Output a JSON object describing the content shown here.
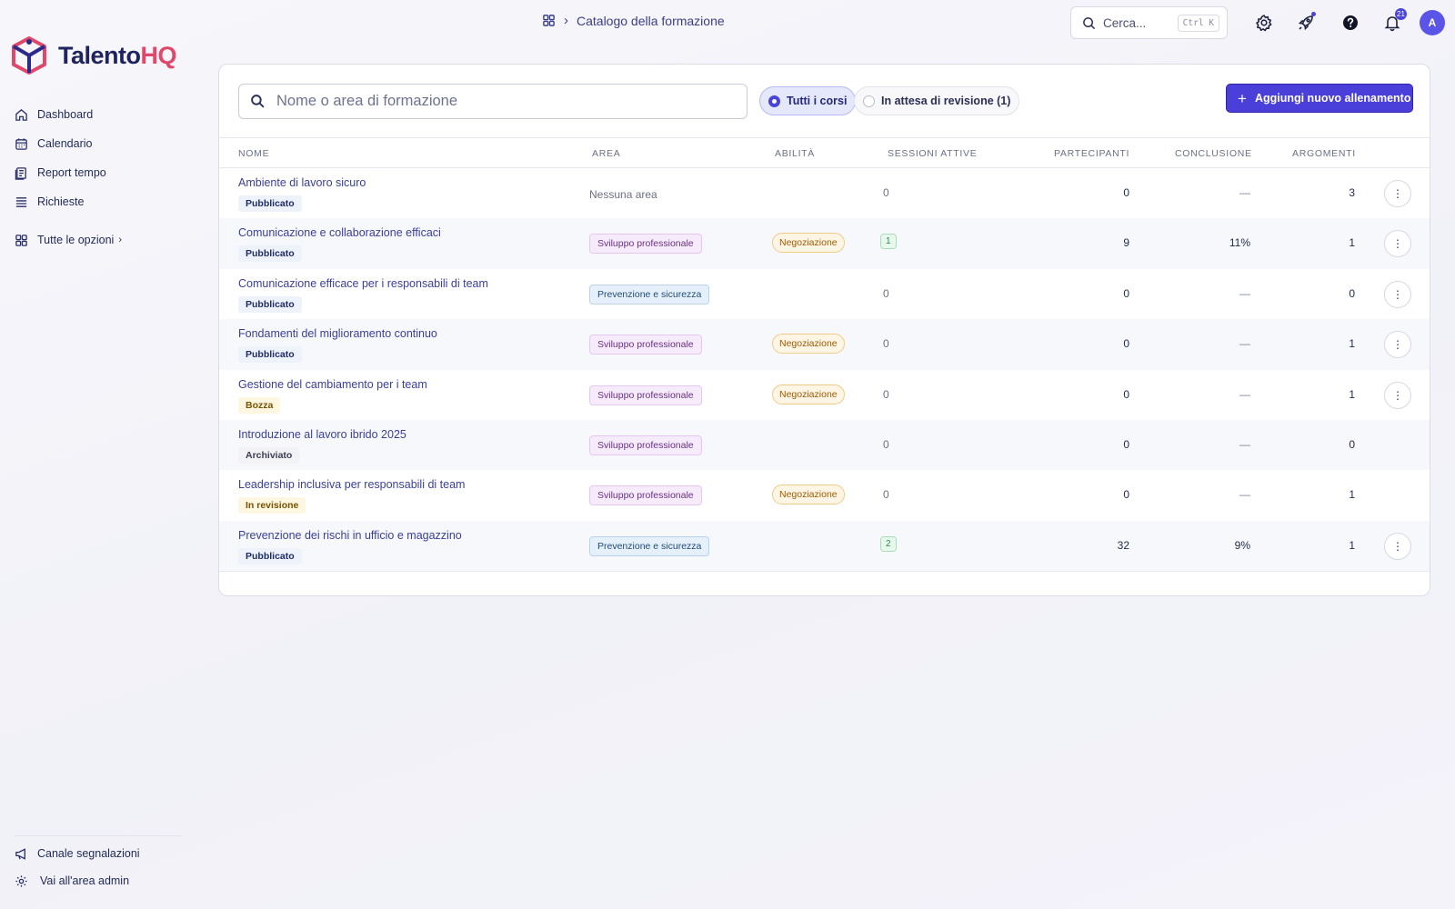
{
  "app": {
    "logo_main": "Talento",
    "logo_accent": "HQ"
  },
  "sidebar": {
    "items": [
      {
        "label": "Dashboard",
        "icon": "home-icon"
      },
      {
        "label": "Calendario",
        "icon": "calendar-icon"
      },
      {
        "label": "Report tempo",
        "icon": "report-icon"
      },
      {
        "label": "Richieste",
        "icon": "list-icon"
      }
    ],
    "all_options": "Tutte le opzioni",
    "bottom": [
      {
        "label": "Canale segnalazioni",
        "icon": "megaphone-icon"
      },
      {
        "label": "Vai all'area admin",
        "icon": "gear-icon"
      }
    ]
  },
  "header": {
    "breadcrumb": "Catalogo della formazione",
    "search_placeholder": "Cerca...",
    "search_shortcut": "Ctrl K",
    "notifications_count": "21",
    "avatar_initial": "A"
  },
  "toolbar": {
    "search_placeholder": "Nome o area di formazione",
    "filter_all": "Tutti i corsi",
    "filter_pending": "In attesa di revisione (1)",
    "add_label": "Aggiungi nuovo allenamento"
  },
  "table": {
    "columns": [
      "NOME",
      "AREA",
      "ABILITÀ",
      "SESSIONI ATTIVE",
      "PARTECIPANTI",
      "CONCLUSIONE",
      "ARGOMENTI"
    ],
    "rows": [
      {
        "name": "Ambiente di lavoro sicuro",
        "status": "Pubblicato",
        "status_type": "pub",
        "area": "Nessuna area",
        "area_type": "none",
        "skill": "",
        "sessions": "0",
        "sessions_badge": false,
        "participants": "0",
        "completion": "—",
        "topics": "3",
        "menu": true
      },
      {
        "name": "Comunicazione e collaborazione efficaci",
        "status": "Pubblicato",
        "status_type": "pub",
        "area": "Sviluppo professionale",
        "area_type": "svil",
        "skill": "Negoziazione",
        "sessions": "1",
        "sessions_badge": true,
        "participants": "9",
        "completion": "11%",
        "topics": "1",
        "menu": true
      },
      {
        "name": "Comunicazione efficace per i responsabili di team",
        "status": "Pubblicato",
        "status_type": "pub",
        "area": "Prevenzione e sicurezza",
        "area_type": "prev",
        "skill": "",
        "sessions": "0",
        "sessions_badge": false,
        "participants": "0",
        "completion": "—",
        "topics": "0",
        "menu": true
      },
      {
        "name": "Fondamenti del miglioramento continuo",
        "status": "Pubblicato",
        "status_type": "pub",
        "area": "Sviluppo professionale",
        "area_type": "svil",
        "skill": "Negoziazione",
        "sessions": "0",
        "sessions_badge": false,
        "participants": "0",
        "completion": "—",
        "topics": "1",
        "menu": true
      },
      {
        "name": "Gestione del cambiamento per i team",
        "status": "Bozza",
        "status_type": "draft",
        "area": "Sviluppo professionale",
        "area_type": "svil",
        "skill": "Negoziazione",
        "sessions": "0",
        "sessions_badge": false,
        "participants": "0",
        "completion": "—",
        "topics": "1",
        "menu": true
      },
      {
        "name": "Introduzione al lavoro ibrido 2025",
        "status": "Archiviato",
        "status_type": "arch",
        "area": "Sviluppo professionale",
        "area_type": "svil",
        "skill": "",
        "sessions": "0",
        "sessions_badge": false,
        "participants": "0",
        "completion": "—",
        "topics": "0",
        "menu": false
      },
      {
        "name": "Leadership inclusiva per responsabili di team",
        "status": "In revisione",
        "status_type": "rev",
        "area": "Sviluppo professionale",
        "area_type": "svil",
        "skill": "Negoziazione",
        "sessions": "0",
        "sessions_badge": false,
        "participants": "0",
        "completion": "—",
        "topics": "1",
        "menu": false
      },
      {
        "name": "Prevenzione dei rischi in ufficio e magazzino",
        "status": "Pubblicato",
        "status_type": "pub",
        "area": "Prevenzione e sicurezza",
        "area_type": "prev",
        "skill": "",
        "sessions": "2",
        "sessions_badge": true,
        "participants": "32",
        "completion": "9%",
        "topics": "1",
        "menu": true
      }
    ]
  }
}
